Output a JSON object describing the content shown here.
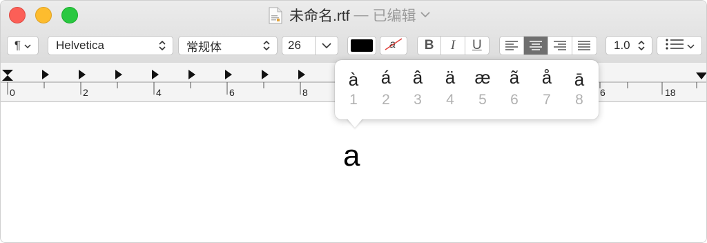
{
  "window": {
    "title": "未命名.rtf",
    "separator": "—",
    "edited": "已编辑",
    "title_chevron_icon": "chevron-down-icon",
    "doc_icon": "rtf-document-icon"
  },
  "toolbar": {
    "paragraph_styles_icon": "pilcrow-icon",
    "font_family": "Helvetica",
    "font_style": "常规体",
    "font_size": "26",
    "text_color": "#000000",
    "bold_label": "B",
    "italic_label": "I",
    "underline_label": "U",
    "line_spacing": "1.0",
    "alignment_selected": "center",
    "list_icon": "bulleted-list-icon"
  },
  "ruler": {
    "numbers": [
      "0",
      "2",
      "4",
      "6",
      "8",
      "6",
      "18"
    ]
  },
  "document": {
    "typed_text": "a"
  },
  "accent_popover": {
    "options": [
      {
        "char": "à",
        "key": "1"
      },
      {
        "char": "á",
        "key": "2"
      },
      {
        "char": "â",
        "key": "3"
      },
      {
        "char": "ä",
        "key": "4"
      },
      {
        "char": "æ",
        "key": "5"
      },
      {
        "char": "ã",
        "key": "6"
      },
      {
        "char": "å",
        "key": "7"
      },
      {
        "char": "ā",
        "key": "8"
      }
    ]
  },
  "colors": {
    "close": "#fc5f57",
    "minimize": "#fdbc2e",
    "zoom": "#29c840",
    "selected_segment": "#6f6f6f"
  }
}
